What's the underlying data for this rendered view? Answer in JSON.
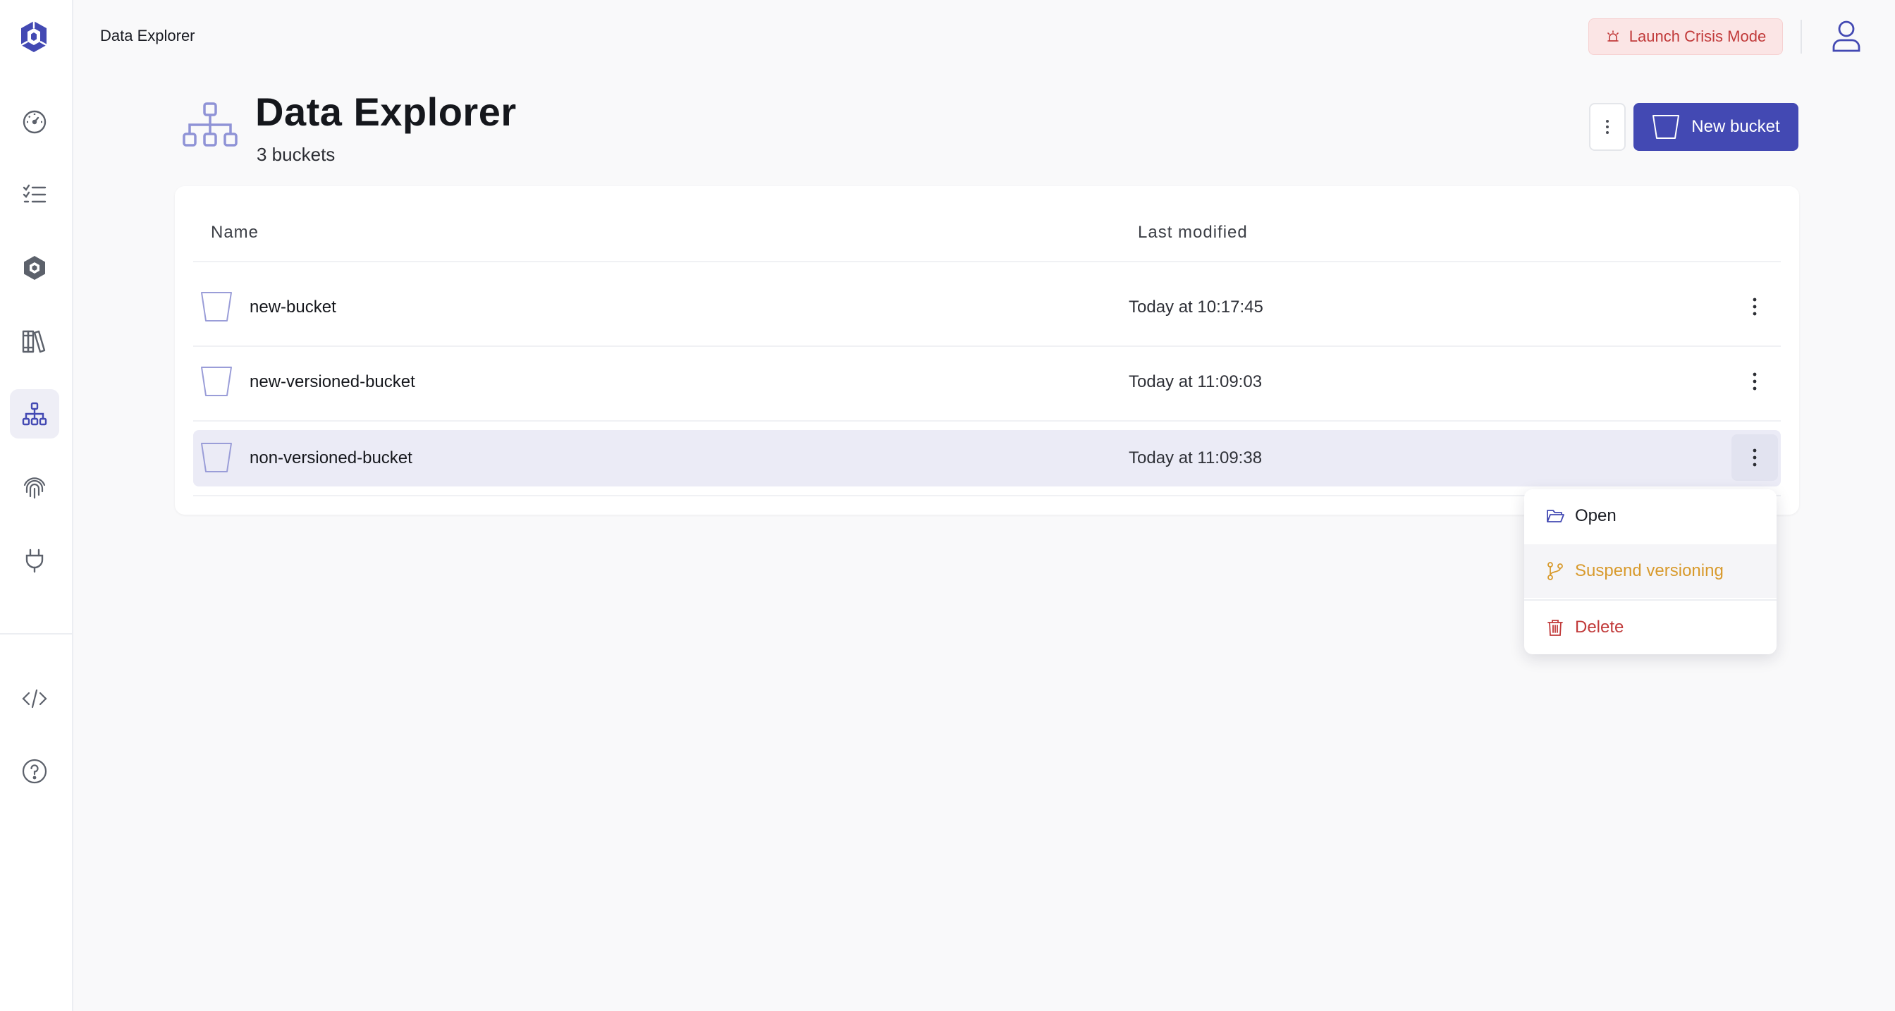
{
  "app": {
    "breadcrumb": "Data Explorer",
    "crisis_label": "Launch Crisis Mode",
    "accent": "#4349b3",
    "danger": "#c13a3a",
    "warning": "#d89a2c"
  },
  "sidebar": {
    "items": [
      {
        "icon": "dashboard-icon"
      },
      {
        "icon": "tasks-list-icon"
      },
      {
        "icon": "hexagon-network-icon"
      },
      {
        "icon": "library-books-icon"
      },
      {
        "icon": "sitemap-icon",
        "active": true
      },
      {
        "icon": "fingerprint-icon"
      },
      {
        "icon": "plug-icon"
      },
      {
        "icon": "code-icon"
      },
      {
        "icon": "help-icon"
      }
    ]
  },
  "header": {
    "title": "Data Explorer",
    "subtitle": "3 buckets",
    "new_bucket_label": "New bucket"
  },
  "table": {
    "columns": [
      "Name",
      "Last modified"
    ],
    "rows": [
      {
        "name": "new-bucket",
        "modified": "Today at 10:17:45"
      },
      {
        "name": "new-versioned-bucket",
        "modified": "Today at 11:09:03"
      },
      {
        "name": "non-versioned-bucket",
        "modified": "Today at 11:09:38",
        "selected": true
      }
    ]
  },
  "menu": {
    "open": "Open",
    "suspend": "Suspend versioning",
    "delete": "Delete"
  }
}
